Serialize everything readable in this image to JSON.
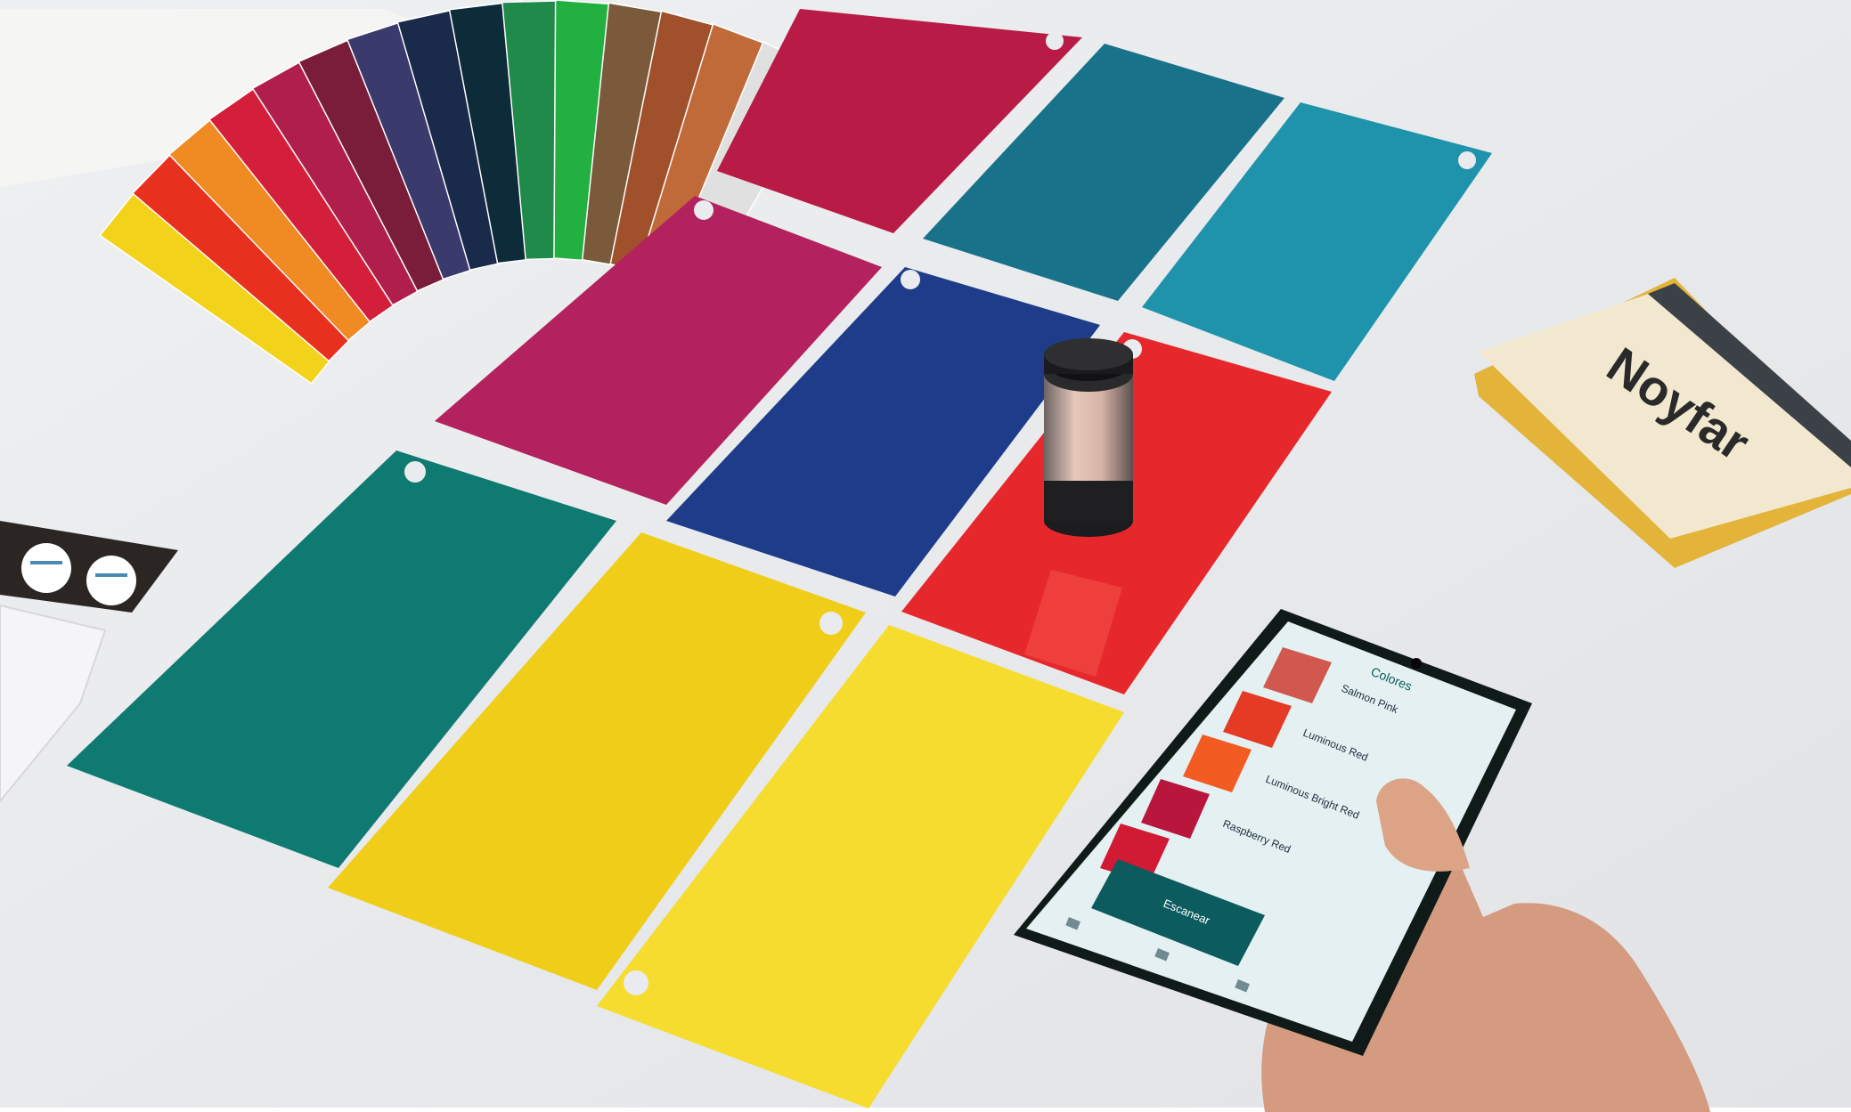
{
  "photo": {
    "background_color": "#e9ebee",
    "frame_color": "#ffffff"
  },
  "swatch_fan": {
    "colors": [
      "#f3d21a",
      "#e8301f",
      "#f08a22",
      "#d41f3a",
      "#b01e4c",
      "#7a1d3a",
      "#3a3a6c",
      "#1a2a4a",
      "#0e2b3a",
      "#1f8a4a",
      "#22b040",
      "#7a5a3a",
      "#a0502a",
      "#c06a3a",
      "#e0e0e0"
    ]
  },
  "panels": [
    {
      "id": "crimson",
      "color": "#b81b45"
    },
    {
      "id": "teal-dark",
      "color": "#18728a"
    },
    {
      "id": "teal-light",
      "color": "#1f93ab"
    },
    {
      "id": "magenta",
      "color": "#b3225e"
    },
    {
      "id": "navy",
      "color": "#1e3c8a"
    },
    {
      "id": "red",
      "color": "#e6282c"
    },
    {
      "id": "green",
      "color": "#0f7a72"
    },
    {
      "id": "yellow-left",
      "color": "#f0cd18"
    },
    {
      "id": "yellow-right",
      "color": "#f6dc2e"
    }
  ],
  "notebook": {
    "brand": "Noyfar",
    "cover_color": "#f1e8cf",
    "spine_color": "#3c4148",
    "edge_color": "#e3b33a"
  },
  "left_card": {
    "background": "#2a2522"
  },
  "phone": {
    "app": {
      "title": "Colores",
      "primary_button": "Escanear",
      "accent_color": "#0c5b5f"
    },
    "list_items": [
      {
        "name": "Salmon Pink",
        "color": "#d0584e"
      },
      {
        "name": "Luminous Red",
        "color": "#e53a24"
      },
      {
        "name": "Luminous Bright Red",
        "color": "#f25c22"
      },
      {
        "name": "Raspberry Red",
        "color": "#b8163c"
      },
      {
        "name": "",
        "color": "#d11a33"
      }
    ]
  }
}
